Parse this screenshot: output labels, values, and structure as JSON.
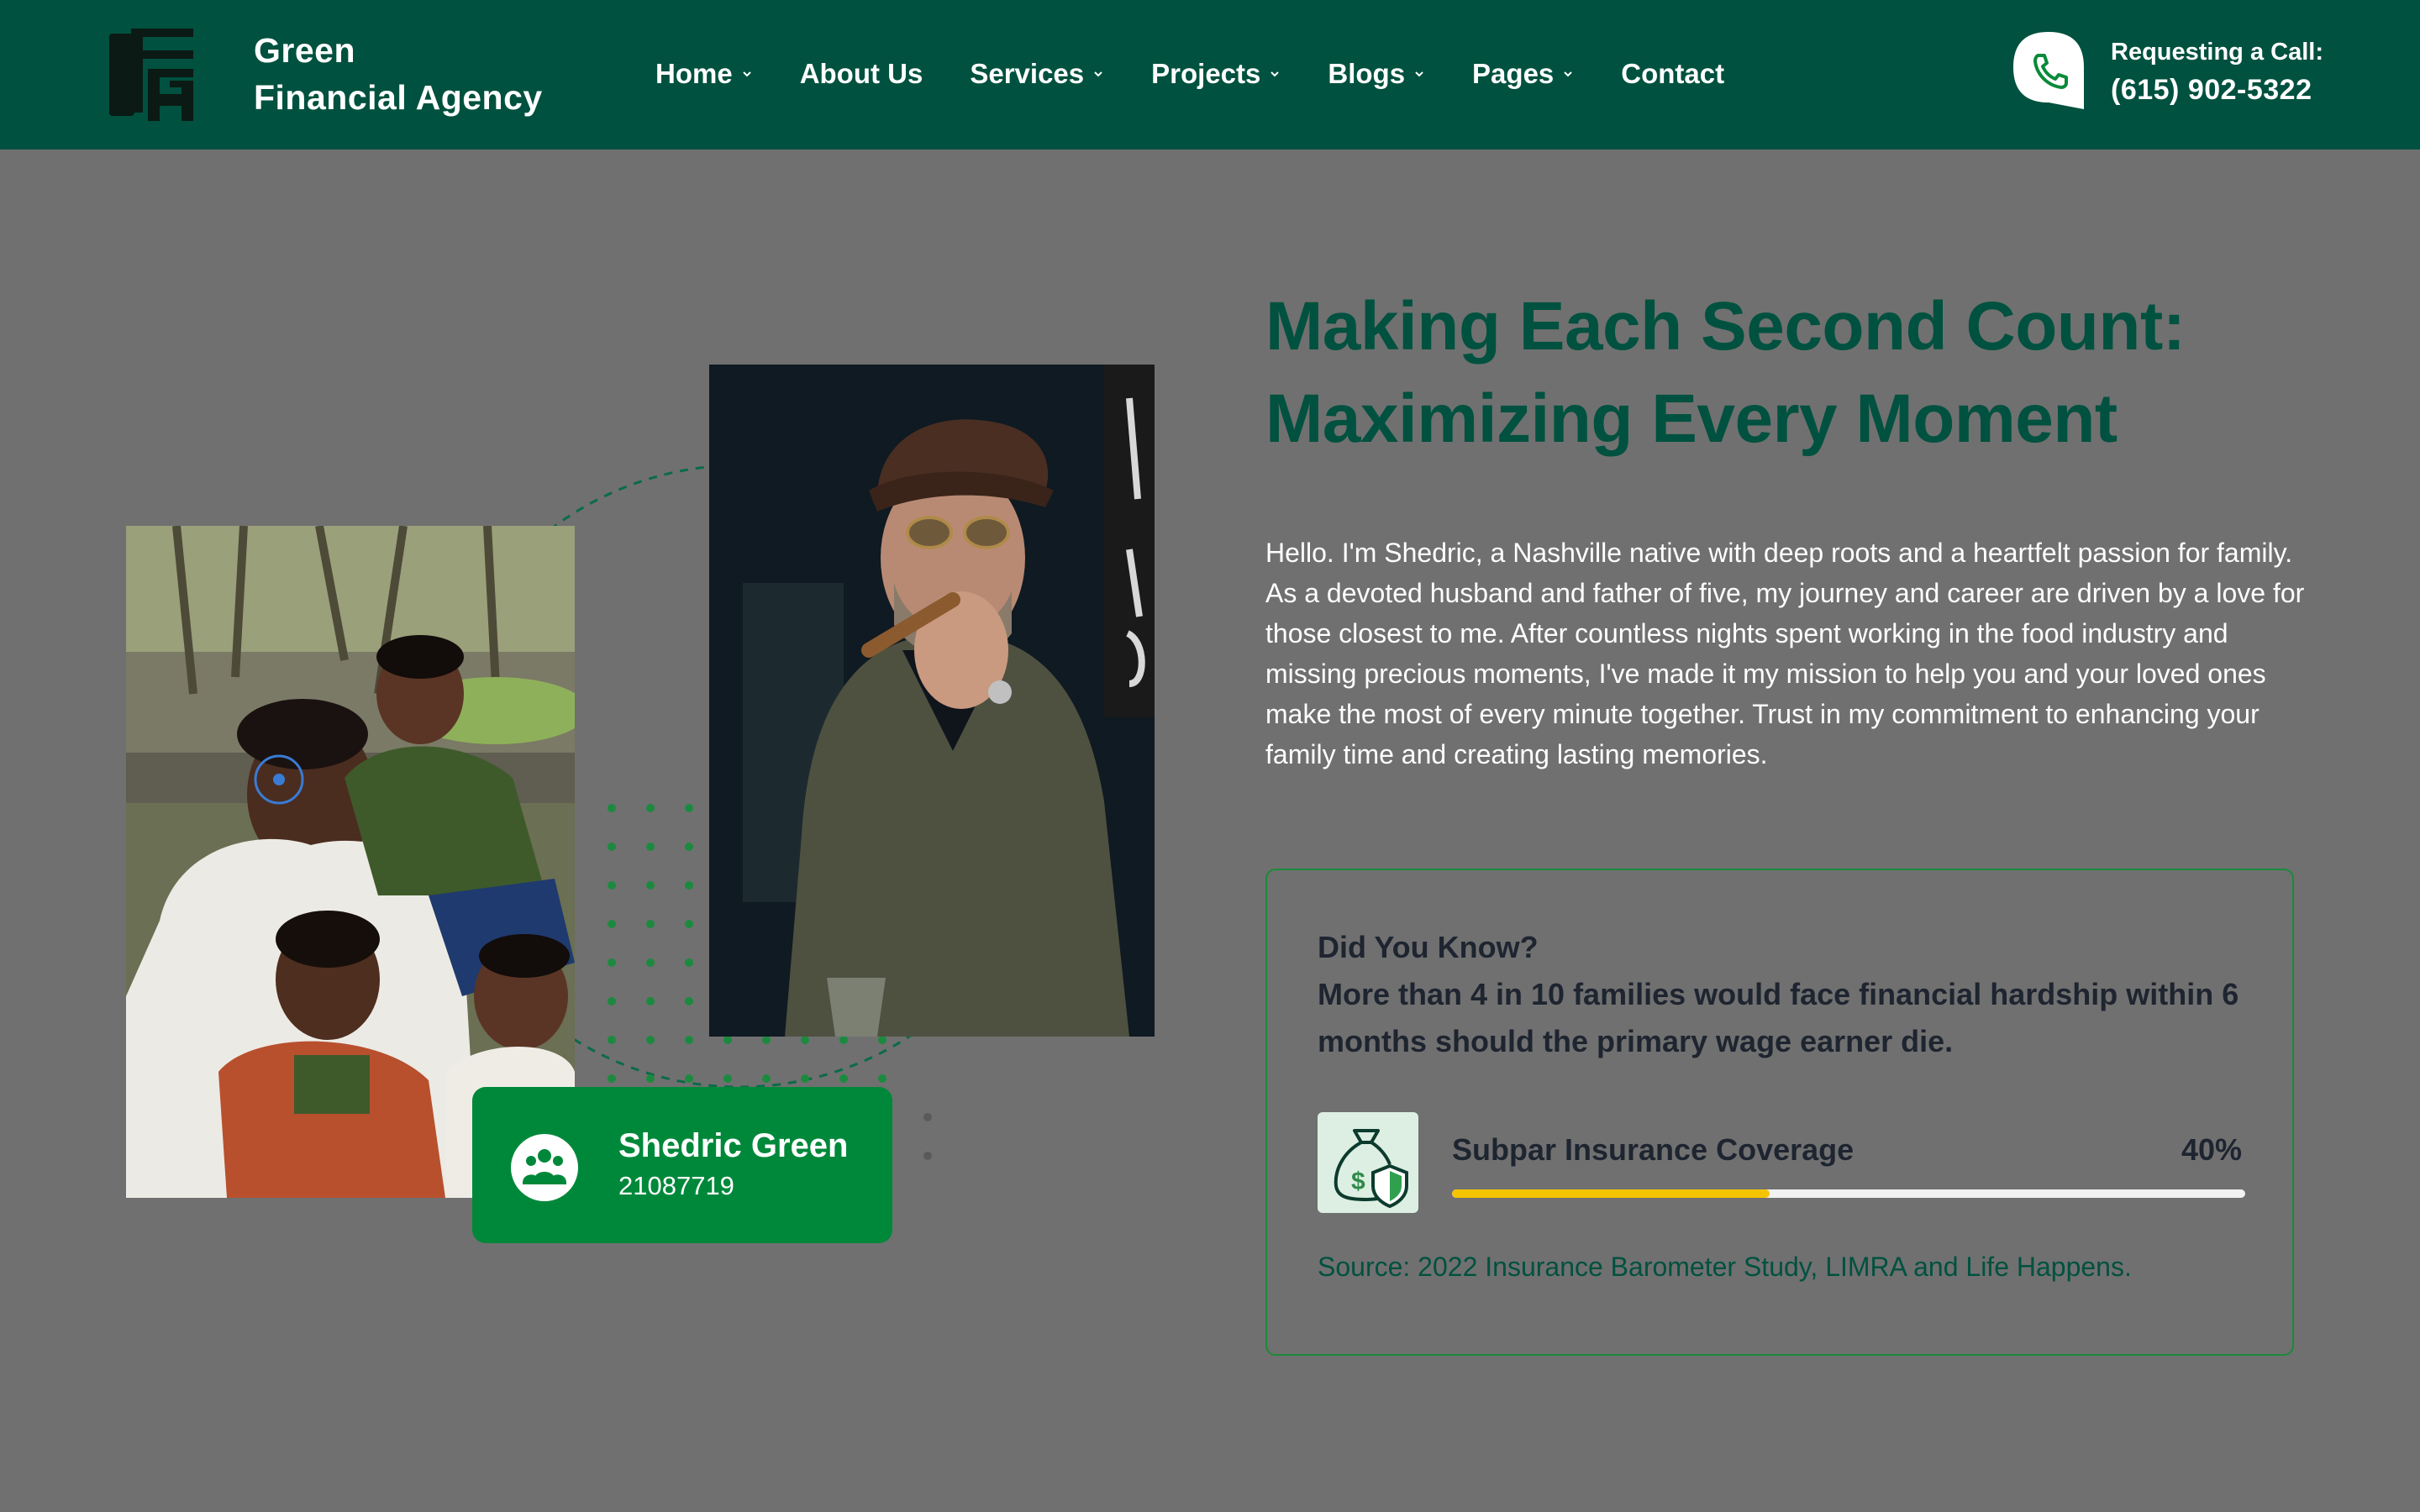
{
  "header": {
    "brand_line1": "Green",
    "brand_line2": "Financial Agency",
    "logo": "agency-logo-icon",
    "nav": [
      {
        "label": "Home",
        "has_dropdown": true
      },
      {
        "label": "About Us",
        "has_dropdown": false
      },
      {
        "label": "Services",
        "has_dropdown": true
      },
      {
        "label": "Projects",
        "has_dropdown": true
      },
      {
        "label": "Blogs",
        "has_dropdown": true
      },
      {
        "label": "Pages",
        "has_dropdown": true
      },
      {
        "label": "Contact",
        "has_dropdown": false
      }
    ],
    "call_label": "Requesting a Call:",
    "call_number": "(615) 902-5322",
    "call_icon": "phone-icon"
  },
  "profile_card": {
    "name": "Shedric Green",
    "id": "21087719",
    "icon": "group-users-icon"
  },
  "hero": {
    "headline_line1": "Making Each Second Count:",
    "headline_line2": "Maximizing Every Moment",
    "bio": "Hello. I'm Shedric, a Nashville native with deep roots and a heartfelt passion for family. As a devoted husband and father of five, my journey and career are driven by a love for those closest to me. After countless nights spent working in the food industry and missing precious moments, I've made it my mission to help you and your loved ones make the most of every minute together. Trust in my commitment to enhancing your family time and creating lasting memories."
  },
  "fact": {
    "title_line1": "Did You Know?",
    "title_line2": "More than 4 in 10 families would face financial hardship within 6",
    "title_line3": "months should the primary wage earner die.",
    "stat_icon": "money-bag-shield-icon",
    "stat_label": "Subpar Insurance Coverage",
    "stat_value": "40%",
    "stat_fraction": 0.4,
    "source": "Source: 2022 Insurance Barometer Study, LIMRA and Life Happens."
  },
  "colors": {
    "header_bg": "#00513f",
    "page_bg": "#707070",
    "accent_green": "#00883a",
    "progress_fill": "#f5c400"
  }
}
